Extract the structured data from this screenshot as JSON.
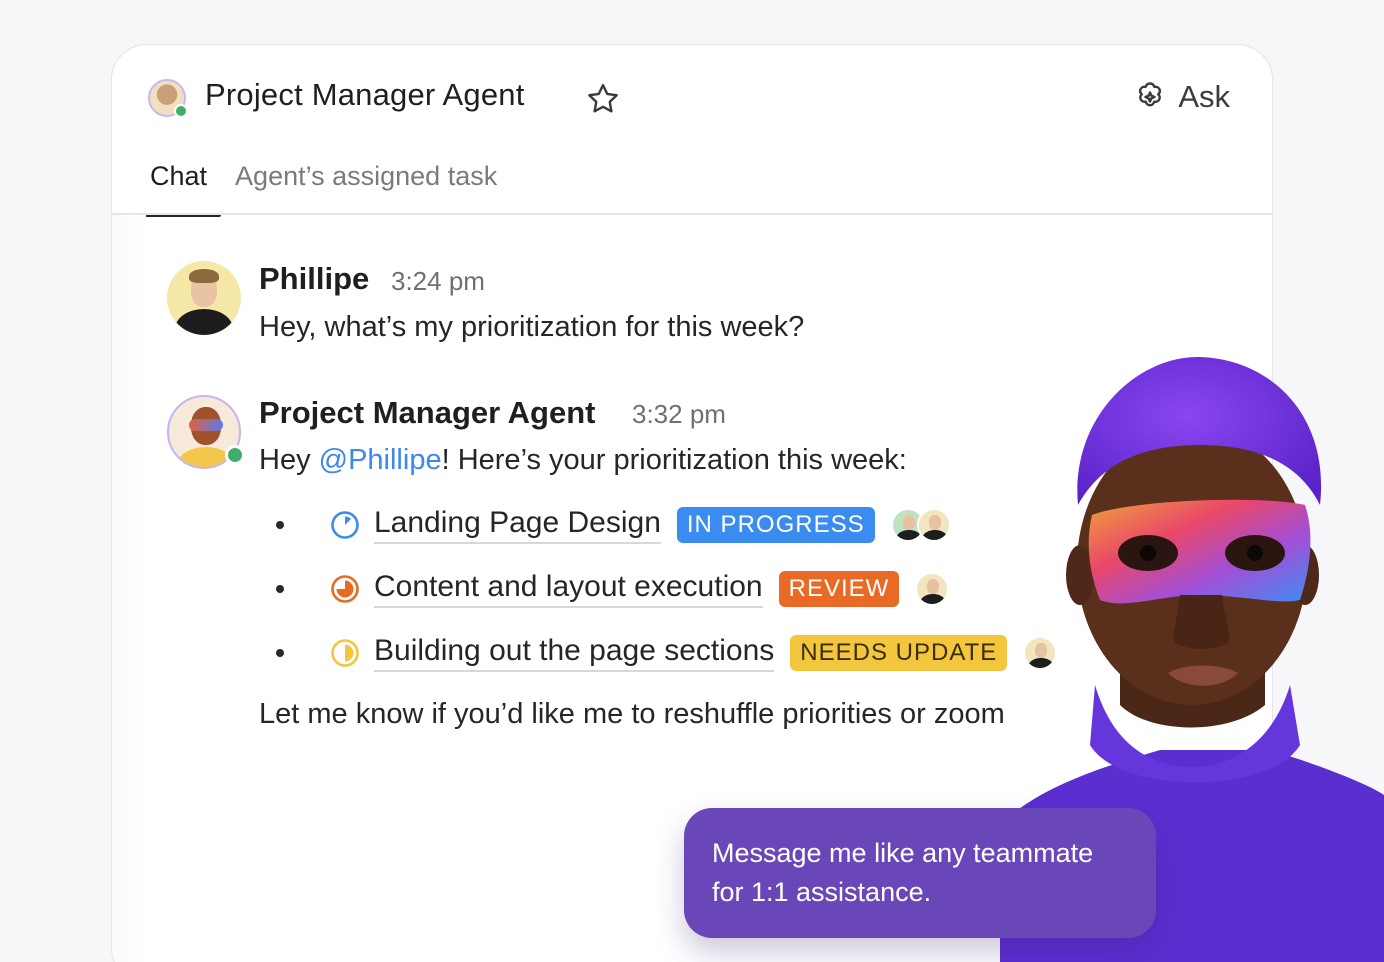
{
  "header": {
    "title": "Project Manager Agent",
    "ask_label": "Ask"
  },
  "tabs": [
    {
      "label": "Chat",
      "active": true
    },
    {
      "label": "Agent’s assigned task",
      "active": false
    }
  ],
  "messages": [
    {
      "author": "Phillipe",
      "time": "3:24 pm",
      "text": "Hey, what’s my prioritization for this week?"
    },
    {
      "author": "Project Manager Agent",
      "time": "3:32 pm",
      "greeting_prefix": "Hey ",
      "mention": "@Phillipe",
      "greeting_suffix": "! Here’s your prioritization this week:",
      "tasks": [
        {
          "name": "Landing Page Design",
          "status": "IN PROGRESS",
          "status_color": "#3b8cf0",
          "icon": "in-progress-icon"
        },
        {
          "name": "Content and layout execution",
          "status": "REVIEW",
          "status_color": "#e86a25",
          "icon": "review-icon"
        },
        {
          "name": "Building out the page sections",
          "status": "NEEDS UPDATE",
          "status_color": "#f4c63e",
          "icon": "needs-update-icon"
        }
      ],
      "closing": "Let me know if you’d like me to reshuffle priorities or zoom"
    }
  ],
  "bubble": {
    "line1": "Message me like any teammate",
    "line2": "for 1:1 assistance."
  },
  "colors": {
    "accent": "#6a47b8",
    "mention": "#3f86ee",
    "online": "#3fae6a"
  }
}
